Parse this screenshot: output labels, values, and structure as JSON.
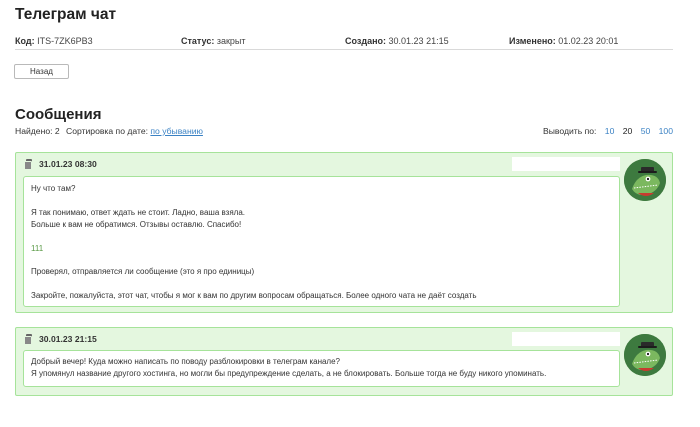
{
  "page": {
    "title": "Телеграм чат"
  },
  "meta": {
    "code_label": "Код:",
    "code_value": "ITS-7ZK6PB3",
    "status_label": "Статус:",
    "status_value": "закрыт",
    "created_label": "Создано:",
    "created_value": "30.01.23 21:15",
    "changed_label": "Изменено:",
    "changed_value": "01.02.23 20:01"
  },
  "back_button": "Назад",
  "messages_section": {
    "title": "Сообщения",
    "found_label": "Найдено:",
    "found_count": "2",
    "sort_label": "Сортировка по дате:",
    "sort_value": "по убыванию",
    "per_page_label": "Выводить по:",
    "per_page_options": [
      "10",
      "20",
      "50",
      "100"
    ],
    "per_page_selected": "20"
  },
  "messages": [
    {
      "date": "31.01.23 08:30",
      "lines": [
        "Ну что там?",
        "",
        "Я так понимаю, ответ ждать не стоит. Ладно, ваша взяла.",
        "Больше к вам не обратимся. Отзывы оставлю. Спасибо!",
        "",
        "111",
        "",
        "Проверял, отправляется ли сообщение (это я про единицы)",
        "",
        "Закройте, пожалуйста, этот чат, чтобы я мог к вам по другим вопросам обращаться. Более одного чата не даёт создать"
      ]
    },
    {
      "date": "30.01.23 21:15",
      "lines": [
        "Добрый вечер! Куда можно написать по поводу разблокировки в телеграм канале?",
        "Я упомянул название другого хостинга, но могли бы предупреждение сделать, а не блокировать. Больше тогда не буду никого упоминать."
      ]
    }
  ],
  "colors": {
    "accent": "#3b82c4",
    "card_bg": "#e4f7df",
    "card_border": "#a6e39a"
  },
  "icons": {
    "copy": "copy-icon",
    "avatar": "crocodile-avatar"
  }
}
